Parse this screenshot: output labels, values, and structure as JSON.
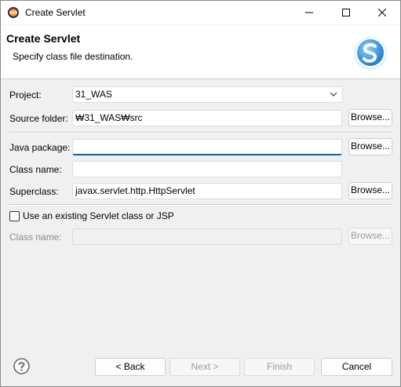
{
  "window": {
    "title": "Create Servlet"
  },
  "header": {
    "title": "Create Servlet",
    "subtitle": "Specify class file destination."
  },
  "form": {
    "project_label": "Project:",
    "project_value": "31_WAS",
    "source_folder_label": "Source folder:",
    "source_folder_value": "₩31_WAS₩src",
    "java_package_label": "Java package:",
    "java_package_value": "",
    "class_name_label": "Class name:",
    "class_name_value": "",
    "superclass_label": "Superclass:",
    "superclass_value": "javax.servlet.http.HttpServlet",
    "browse_label": "Browse...",
    "existing_checkbox_label": "Use an existing Servlet class or JSP",
    "existing_checked": false,
    "existing_class_name_label": "Class name:",
    "existing_class_name_value": ""
  },
  "footer": {
    "back_label": "< Back",
    "next_label": "Next >",
    "finish_label": "Finish",
    "cancel_label": "Cancel"
  },
  "icons": {
    "app": "eclipse-icon",
    "help": "help-icon",
    "logo": "servlet-logo-icon"
  },
  "colors": {
    "accent": "#0a64a4",
    "logo_blue": "#2f8fd6"
  }
}
